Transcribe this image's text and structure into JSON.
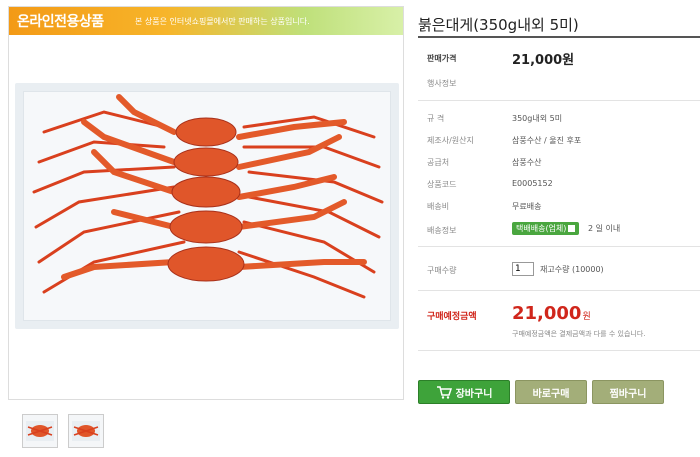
{
  "banner": {
    "title": "온라인전용상품",
    "subtitle": "본 상품은 인터넷쇼핑몰에서만 판매하는 상품입니다."
  },
  "product": {
    "title": "붉은대게(350g내외 5미)",
    "sale_price_label": "판매가격",
    "sale_price": "21,000원",
    "event_label": "행사정보",
    "spec_label": "규 격",
    "spec_value": "350g내외 5미",
    "origin_label": "제조사/원산지",
    "origin_value": "삼풍수산 / 울진 후포",
    "supplier_label": "공급처",
    "supplier_value": "삼풍수산",
    "code_label": "상품코드",
    "code_value": "E0005152",
    "shipping_fee_label": "배송비",
    "shipping_fee_value": "무료배송",
    "shipping_info_label": "배송정보",
    "shipping_badge": "택배배송(업체)",
    "shipping_days": "2 일 이내",
    "qty_label": "구매수량",
    "qty_value": "1",
    "stock_text": "재고수량 (10000)",
    "total_label": "구매예정금액",
    "total_value": "21,000",
    "total_unit": "원",
    "total_note": "구매예정금액은 결제금액과 다를 수 있습니다."
  },
  "buttons": {
    "cart": "장바구니",
    "buy": "바로구매",
    "wish": "찜바구니"
  },
  "colors": {
    "accent_red": "#d0261b",
    "cart_green": "#3ea33a",
    "secondary_olive": "#a3ae79",
    "banner_orange": "#f39a16"
  }
}
